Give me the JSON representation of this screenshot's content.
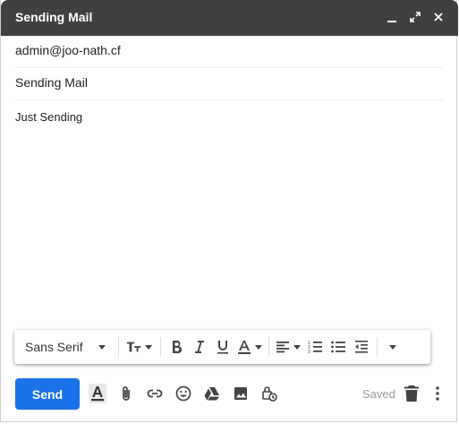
{
  "window": {
    "title": "Sending Mail"
  },
  "compose": {
    "to": "admin@joo-nath.cf",
    "subject": "Sending Mail",
    "body": "Just Sending"
  },
  "format_toolbar": {
    "font": "Sans Serif",
    "buttons": [
      "text-size-icon",
      "bold-icon",
      "italic-icon",
      "underline-icon",
      "text-color-icon",
      "align-icon",
      "numbered-list-icon",
      "bulleted-list-icon",
      "indent-less-icon",
      "more-formatting-icon"
    ]
  },
  "bottom_bar": {
    "send_label": "Send",
    "status": "Saved",
    "icons": [
      "formatting-options-icon",
      "attach-icon",
      "link-icon",
      "emoji-icon",
      "drive-icon",
      "photo-icon",
      "confidential-icon",
      "trash-icon",
      "more-options-icon"
    ]
  },
  "colors": {
    "titlebar": "#404040",
    "send_button": "#1a73e8"
  }
}
